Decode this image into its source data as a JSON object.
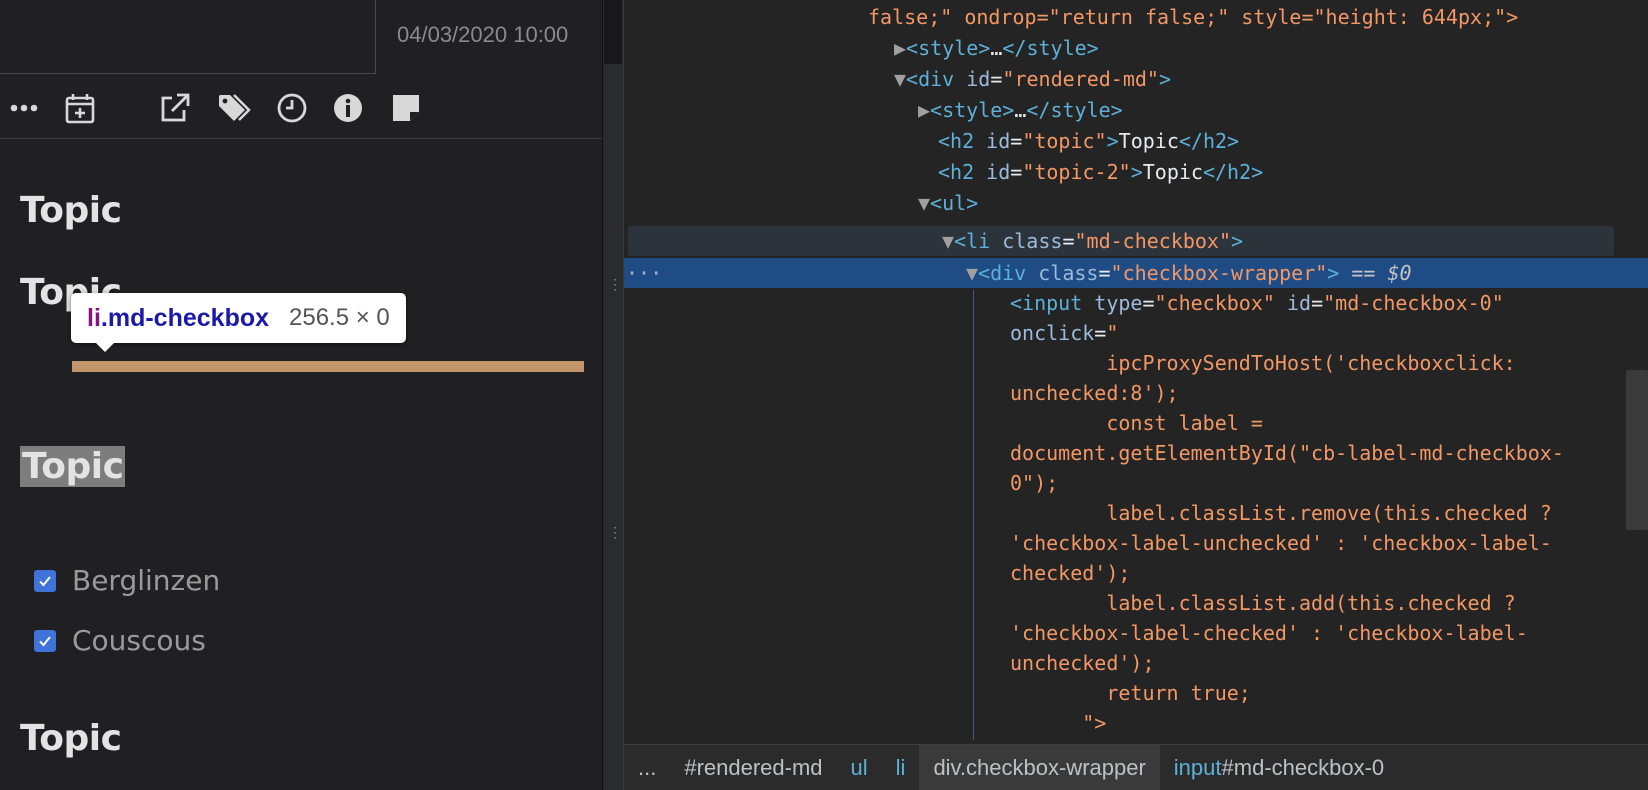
{
  "note": {
    "timestamp": "04/03/2020 10:00",
    "headings": [
      "Topic",
      "Topic",
      "Topic",
      "Topic"
    ],
    "tooltip": {
      "tag": "li",
      "cls": ".md-checkbox",
      "size": "256.5 × 0"
    },
    "checkboxes": [
      {
        "label": "Berglinzen",
        "checked": true
      },
      {
        "label": "Couscous",
        "checked": true
      }
    ]
  },
  "toolbar_icons": [
    "more-icon",
    "calendar-add-icon",
    "open-external-icon",
    "tags-icon",
    "clock-icon",
    "info-icon",
    "note-icon"
  ],
  "dom": {
    "l1_attr": "false;\" ondrop=\"return false;\" style=\"height: 644px;\">",
    "style_open": "<style>",
    "style_mid": "…",
    "style_close": "</style>",
    "div_open": "<div ",
    "id_attr": "id",
    "rendered_id": "\"rendered-md\"",
    "gt": ">",
    "h2_open": "<h2 ",
    "topic_id": "\"topic\"",
    "topic2_id": "\"topic-2\"",
    "h2_text": "Topic",
    "h2_close": "</h2>",
    "ul": "<ul>",
    "li_open": "<li ",
    "class_attr": "class",
    "li_class": "\"md-checkbox\"",
    "wrapper_class": "\"checkbox-wrapper\"",
    "eq0": "== $0",
    "input_open": "<input ",
    "type_attr": "type",
    "type_val": "\"checkbox\"",
    "input_id": "\"md-checkbox-0\"",
    "onclick_attr": "onclick",
    "onclick_q": "\"",
    "code": [
      "        ipcProxySendToHost('checkboxclick:",
      "unchecked:8');",
      "        const label =",
      "document.getElementById(\"cb-label-md-checkbox-",
      "0\");",
      "        label.classList.remove(this.checked ?",
      "'checkbox-label-unchecked' : 'checkbox-label-",
      "checked');",
      "        label.classList.add(this.checked ?",
      "'checkbox-label-checked' : 'checkbox-label-",
      "unchecked');",
      "        return true;",
      "      \">"
    ]
  },
  "crumbs": {
    "more": "...",
    "c1": "#rendered-md",
    "c2": "ul",
    "c3": "li",
    "c4": "div.checkbox-wrapper",
    "c5_tag": "input",
    "c5_id": "#md-checkbox-0"
  },
  "colors": {
    "bar": "#c2956a",
    "selection": "#1f4c85",
    "checkbox": "#3f73d9"
  }
}
